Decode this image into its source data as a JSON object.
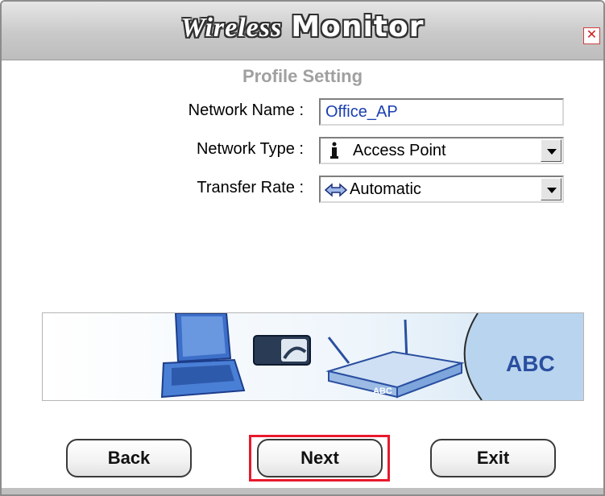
{
  "window": {
    "title_part1": "Wireless",
    "title_part2": "Monitor",
    "close_label": "✕",
    "subtitle": "Profile Setting"
  },
  "form": {
    "network_name": {
      "label": "Network Name :",
      "value": "Office_AP"
    },
    "network_type": {
      "label": "Network Type :",
      "value": "Access Point",
      "icon": "access-point-icon"
    },
    "transfer_rate": {
      "label": "Transfer Rate :",
      "value": "Automatic",
      "icon": "double-arrow-icon"
    }
  },
  "banner": {
    "text": "ABC",
    "router_text": "ABC"
  },
  "buttons": {
    "back": "Back",
    "next": "Next",
    "exit": "Exit"
  },
  "colors": {
    "highlight": "#e8192c",
    "value_text": "#1a3fb0",
    "subtitle": "#a0a0a0"
  }
}
